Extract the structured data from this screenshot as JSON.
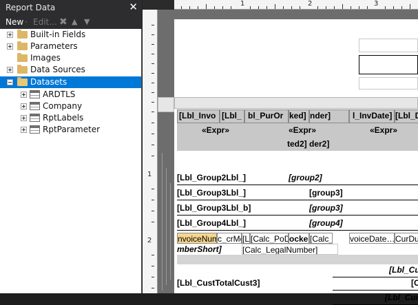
{
  "panel": {
    "title": "Report Data",
    "toolbar": {
      "new_label": "New",
      "separator": "·",
      "edit_label": "Edit..."
    },
    "tree": [
      {
        "label": "Built-in Fields",
        "expander": "plus",
        "icon": "folder-icon"
      },
      {
        "label": "Parameters",
        "expander": "plus",
        "icon": "folder-icon"
      },
      {
        "label": "Images",
        "expander": "none",
        "icon": "folder-icon"
      },
      {
        "label": "Data Sources",
        "expander": "plus",
        "icon": "folder-icon"
      },
      {
        "label": "Datasets",
        "expander": "minus",
        "icon": "folder-open-icon",
        "selected": true
      }
    ],
    "datasets": [
      "ARDTLS",
      "Company",
      "RptLabels",
      "RptParameter"
    ],
    "selection_color": "#0078d7"
  },
  "ruler": {
    "marks": [
      "1",
      "2",
      "3"
    ],
    "left_marks": [
      "1",
      "2"
    ]
  },
  "report": {
    "header_row1": [
      "[Lbl_Invo",
      "[Lbl_",
      "bl_PurOr",
      "ked]",
      "nder]",
      "l_InvDate]",
      "[Lbl_Due"
    ],
    "header_row2": [
      "«Expr»",
      "«Expr»",
      "«Expr»"
    ],
    "header_row3": [
      "ted2]",
      "der2]"
    ],
    "group_rows": [
      {
        "label": "[Lbl_Group2Lbl_]",
        "value": "[group2]",
        "value_italic": true
      },
      {
        "label": "[Lbl_Group3Lbl_]",
        "value": "[group3]",
        "value_italic": false
      },
      {
        "label": "[Lbl_Group3Lbl_b]",
        "value": "[group3]",
        "value_italic": true
      },
      {
        "label": "[Lbl_Group4Lbl_]",
        "value": "[group4]",
        "value_italic": true
      }
    ],
    "detail_row": [
      "nvoiceNum",
      "c_crMé",
      "[L",
      "[Calc_PoD",
      "ocked",
      "[Calc_",
      "voiceDate…",
      "CurDue"
    ],
    "detail_row2": [
      "mberShort]",
      "[Calc_LegalNumber]"
    ],
    "footer_right1": "[Lbl_Cu",
    "footer_left": "[Lbl_CustTotalCust3]",
    "footer_right2": "[C",
    "footer_right3": "[Lbl_Cur"
  }
}
